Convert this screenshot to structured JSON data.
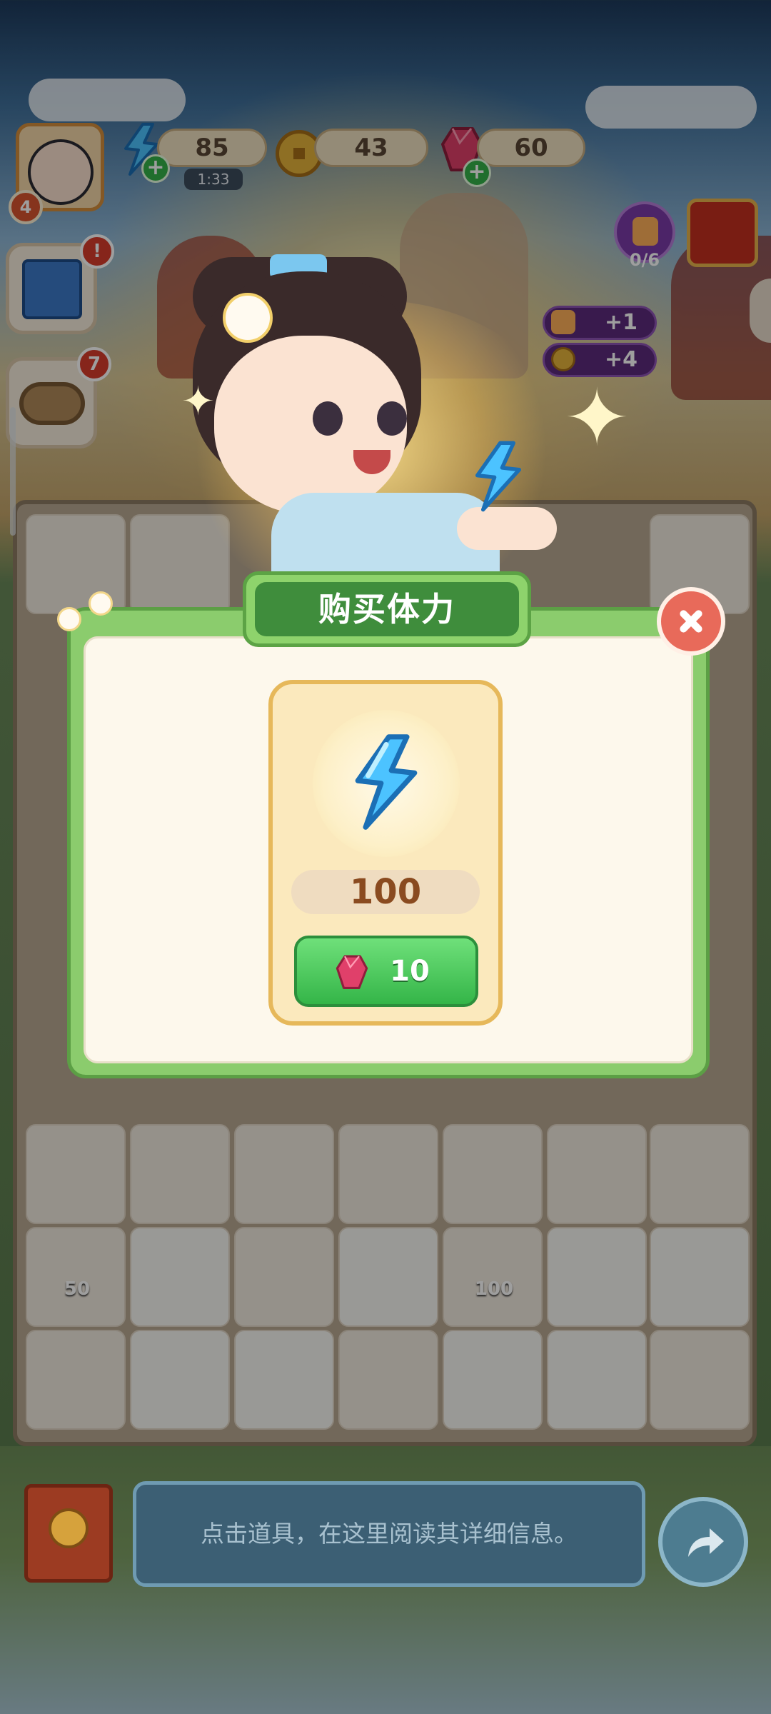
{
  "hud": {
    "level": "4",
    "energy_value": "85",
    "energy_timer": "1:33",
    "coins_value": "43",
    "gems_value": "60",
    "plus_symbol": "+"
  },
  "side_left": {
    "tasks_badge": "!",
    "nest_badge": "7"
  },
  "side_right": {
    "likes_progress": "0/6",
    "reward_likes": "+1",
    "reward_coins": "+4"
  },
  "dialog": {
    "title": "购买体力",
    "energy_amount": "100",
    "price_gems": "10"
  },
  "bottom": {
    "info_text": "点击道具，在这里阅读其详细信息。"
  },
  "board_items": {
    "energy_small_count": "50",
    "energy_large_count": "100"
  },
  "colors": {
    "accent_green": "#3f8d3c",
    "buy_button": "#34b548",
    "energy_blue": "#2fa6ef",
    "gem_pink": "#e0406a"
  }
}
